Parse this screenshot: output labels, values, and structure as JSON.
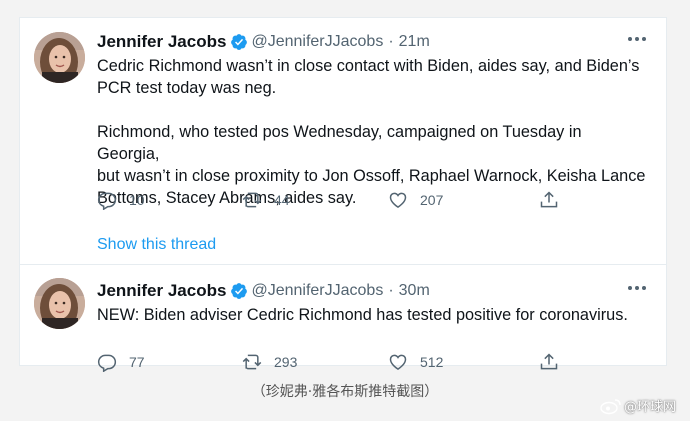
{
  "tweets": [
    {
      "name": "Jennifer Jacobs",
      "handle": "@JenniferJJacobs",
      "dot": "·",
      "time": "21m",
      "text": "Cedric Richmond wasn’t in close contact with Biden, aides say, and Biden’s\nPCR test today was neg.\n\nRichmond, who tested pos Wednesday, campaigned on Tuesday in Georgia,\nbut wasn’t in close proximity to Jon Ossoff, Raphael Warnock, Keisha Lance\nBottoms, Stacey Abrams, aides say.",
      "replies": "10",
      "retweets": "44",
      "likes": "207",
      "show_thread": "Show this thread"
    },
    {
      "name": "Jennifer Jacobs",
      "handle": "@JenniferJJacobs",
      "dot": "·",
      "time": "30m",
      "text": "NEW: Biden adviser Cedric Richmond has tested positive for coronavirus.",
      "replies": "77",
      "retweets": "293",
      "likes": "512"
    }
  ],
  "caption": "（珍妮弗·雅各布斯推特截图）",
  "watermark": "@环球网",
  "icons": {
    "verified": "verified-badge-icon",
    "more": "more-dots-icon",
    "reply": "reply-icon",
    "retweet": "retweet-icon",
    "like": "heart-icon",
    "share": "share-icon"
  },
  "colors": {
    "link": "#1d9bf0",
    "muted": "#536471",
    "text": "#0f1419"
  }
}
